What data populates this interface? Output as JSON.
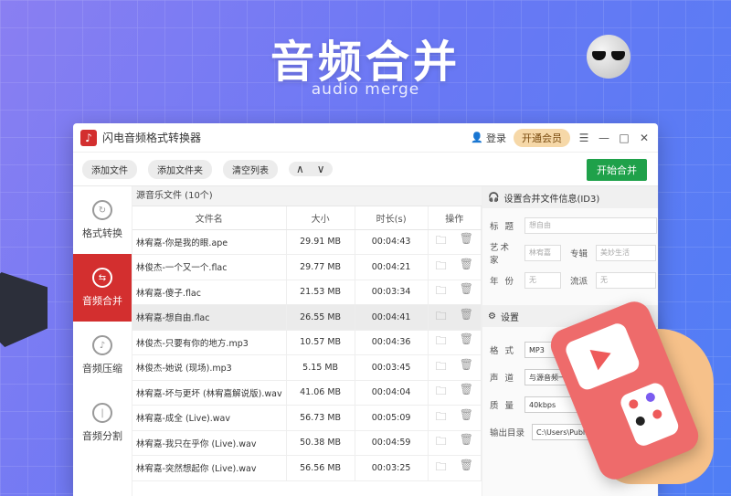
{
  "hero": {
    "title": "音频合并",
    "subtitle": "audio merge"
  },
  "app": {
    "title": "闪电音频格式转换器",
    "logo": "♪",
    "login": "登录",
    "vip": "开通会员"
  },
  "toolbar": {
    "add_file": "添加文件",
    "add_folder": "添加文件夹",
    "clear": "清空列表",
    "up": "∧",
    "down": "∨",
    "merge": "开始合并"
  },
  "sidebar": [
    {
      "label": "格式转换",
      "icon": "refresh-icon",
      "glyph": "↻"
    },
    {
      "label": "音频合并",
      "icon": "merge-icon",
      "glyph": "⇆"
    },
    {
      "label": "音频压缩",
      "icon": "compress-icon",
      "glyph": "♪"
    },
    {
      "label": "音频分割",
      "icon": "split-icon",
      "glyph": "|"
    }
  ],
  "list": {
    "header": "源音乐文件 (10个)",
    "columns": [
      "文件名",
      "大小",
      "时长(s)",
      "操作"
    ],
    "rows": [
      [
        "林宥嘉-你是我的眼.ape",
        "29.91 MB",
        "00:04:43"
      ],
      [
        "林俊杰-一个又一个.flac",
        "29.77 MB",
        "00:04:21"
      ],
      [
        "林宥嘉-傻子.flac",
        "21.53 MB",
        "00:03:34"
      ],
      [
        "林宥嘉-想自由.flac",
        "26.55 MB",
        "00:04:41"
      ],
      [
        "林俊杰-只要有你的地方.mp3",
        "10.57 MB",
        "00:04:36"
      ],
      [
        "林俊杰-她说 (现场).mp3",
        "5.15 MB",
        "00:03:45"
      ],
      [
        "林宥嘉-坏与更坏 (林宥嘉解说版).wav",
        "41.06 MB",
        "00:04:04"
      ],
      [
        "林宥嘉-成全 (Live).wav",
        "56.73 MB",
        "00:05:09"
      ],
      [
        "林宥嘉-我只在乎你 (Live).wav",
        "50.38 MB",
        "00:04:59"
      ],
      [
        "林宥嘉-突然想起你 (Live).wav",
        "56.56 MB",
        "00:03:25"
      ]
    ]
  },
  "meta": {
    "header": "设置合并文件信息(ID3)",
    "title_label": "标 题",
    "title_ph": "想自由",
    "artist_label": "艺术家",
    "artist_ph": "林宥嘉",
    "album_label": "专辑",
    "album_ph": "美妙生活",
    "year_label": "年 份",
    "year_ph": "无",
    "genre_label": "流派",
    "genre_ph": "无"
  },
  "settings": {
    "header": "设置",
    "format_label": "格 式",
    "format_value": "MP3",
    "channel_label": "声 道",
    "channel_value": "与源音频一致",
    "quality_label": "质 量",
    "quality_value": "40kbps",
    "output_label": "输出目录",
    "output_value": "C:\\Users\\Public\\Music\\"
  }
}
